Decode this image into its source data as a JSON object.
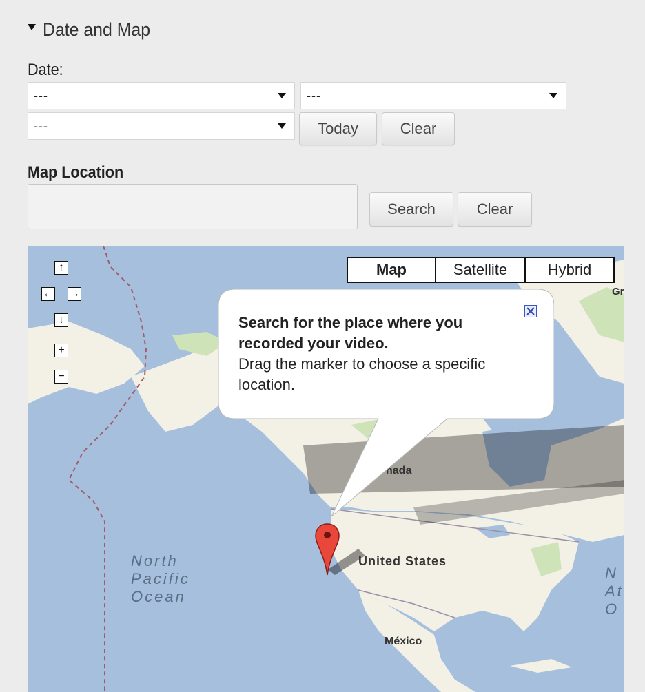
{
  "section": {
    "title": "Date and Map"
  },
  "date": {
    "label": "Date:",
    "month_value": "---",
    "day_value": "---",
    "year_value": "---",
    "today_label": "Today",
    "clear_label": "Clear"
  },
  "location": {
    "label": "Map Location",
    "input_value": "",
    "search_label": "Search",
    "clear_label": "Clear"
  },
  "map": {
    "type_buttons": [
      "Map",
      "Satellite",
      "Hybrid"
    ],
    "active_type": "Map",
    "controls": {
      "up": "↑",
      "left": "←",
      "right": "→",
      "down": "↓",
      "zoom_in": "+",
      "zoom_out": "−"
    },
    "labels": {
      "canada": "nada",
      "usa": "United States",
      "mexico": "México",
      "pacific_1": "North",
      "pacific_2": "Pacific",
      "pacific_3": "Ocean",
      "atlantic_1": "N",
      "atlantic_2": "At",
      "atlantic_3": "O",
      "greenland": "Gr"
    },
    "tooltip": {
      "bold_text": "Search for the place where you recorded your video.",
      "body_text": "Drag the marker to choose a specific location."
    },
    "colors": {
      "water": "#a5bfdd",
      "land": "#f3f0e6",
      "park": "#cfe3b8",
      "marker": "#e8473a"
    }
  }
}
